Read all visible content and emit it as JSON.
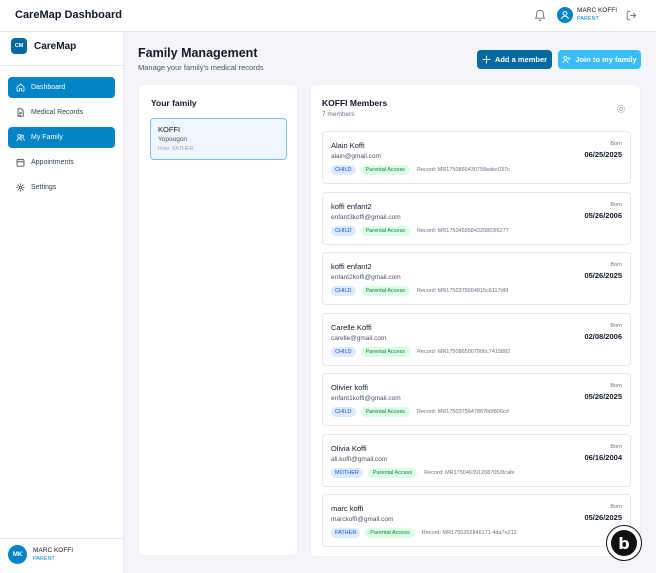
{
  "app": {
    "title": "CareMap Dashboard"
  },
  "top_user": {
    "name": "MARC KOFFI",
    "role": "PARENT"
  },
  "sidebar": {
    "brand_logo": "CM",
    "brand_name": "CareMap",
    "items": [
      {
        "label": "Dashboard",
        "icon": "home-icon",
        "active": true
      },
      {
        "label": "Medical Records",
        "icon": "document-icon",
        "active": false
      },
      {
        "label": "My Family",
        "icon": "users-icon",
        "active": true
      },
      {
        "label": "Appointments",
        "icon": "calendar-icon",
        "active": false
      },
      {
        "label": "Settings",
        "icon": "gear-icon",
        "active": false
      }
    ],
    "user": {
      "initials": "MK",
      "name": "MARC KOFFI",
      "role": "PARENT"
    }
  },
  "header": {
    "title": "Family Management",
    "subtitle": "Manage your family's medical records",
    "add_label": "Add a member",
    "join_label": "Join to my family"
  },
  "family_panel": {
    "title": "Your family",
    "family": {
      "name": "KOFFI",
      "location": "Yopougon",
      "role": "Role: FATHER"
    }
  },
  "members_panel": {
    "title": "KOFFI Members",
    "count": "7 members",
    "born_label": "Born",
    "members": [
      {
        "name": "Alain Koffi",
        "email": "alain@gmail.com",
        "relation": "CHILD",
        "access": "Parental Access",
        "record": "Record: MR1750865430758eabc037c",
        "born": "06/25/2025"
      },
      {
        "name": "koffi enfant2",
        "email": "enfant3koffi@gmail.com",
        "relation": "CHILD",
        "access": "Parental Access",
        "record": "Record: MR1750459584320803l6277",
        "born": "05/26/2006"
      },
      {
        "name": "koffi enfant2",
        "email": "enfant2koffi@gmail.com",
        "relation": "CHILD",
        "access": "Parental Access",
        "record": "Record: MR1750375664815c6117d6f",
        "born": "05/26/2025"
      },
      {
        "name": "Carelle Koffi",
        "email": "carelle@gmail.com",
        "relation": "CHILD",
        "access": "Parental Access",
        "record": "Record: MR1750865007906c7415882",
        "born": "02/08/2006"
      },
      {
        "name": "Olivier koffi",
        "email": "enfant1koffi@gmail.com",
        "relation": "CHILD",
        "access": "Parental Access",
        "record": "Record: MR1750375647867b6f806cd",
        "born": "05/26/2025"
      },
      {
        "name": "Olivia Koffi",
        "email": "ali.koffi@gmail.com",
        "relation": "MOTHER",
        "access": "Parental Access",
        "record": "Record: MR1750463912087053fcafe",
        "born": "06/16/2004"
      },
      {
        "name": "marc koffi",
        "email": "marckoffi@gmail.com",
        "relation": "FATHER",
        "access": "Parental Access",
        "record": "Record: MR1750352846171 4da7e212",
        "born": "05/26/2025"
      }
    ]
  },
  "colors": {
    "accent": "#0284c7",
    "accent_dark": "#0369a1",
    "accent_light": "#38bdf8"
  }
}
